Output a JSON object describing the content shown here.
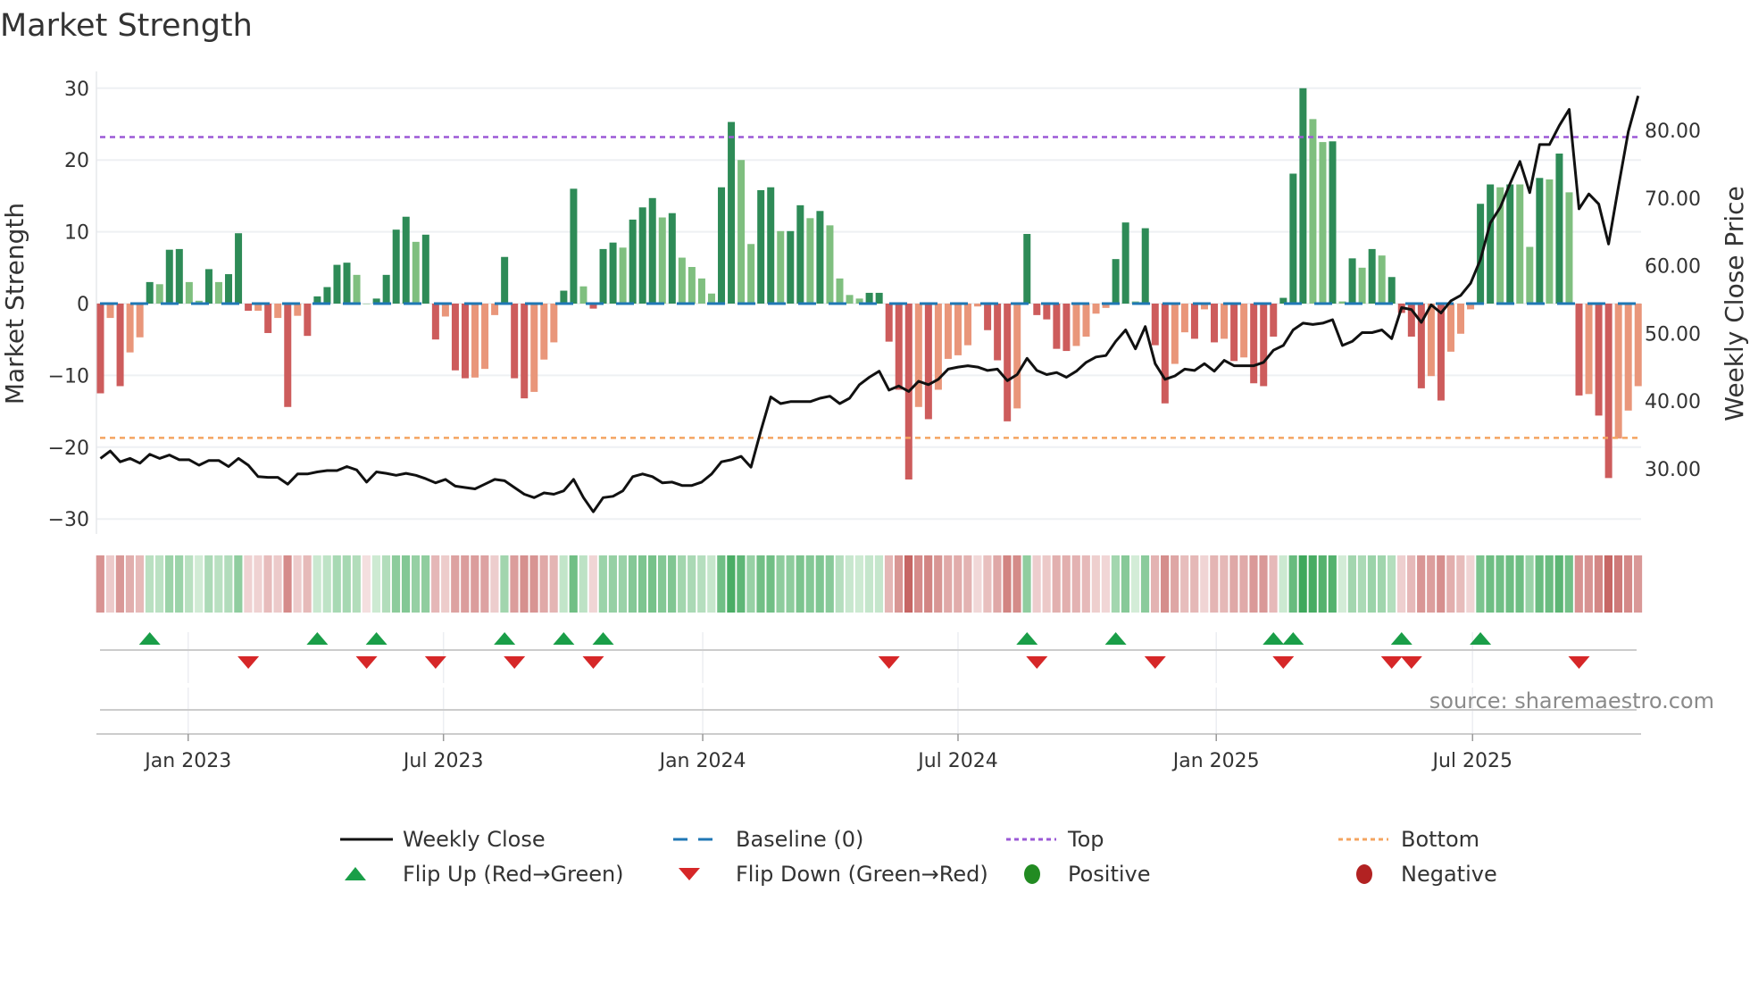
{
  "title": "Market Strength",
  "source": "source: sharemaestro.com",
  "colors": {
    "dark_green": "#2e8b57",
    "light_green": "#7fbf7f",
    "dark_red": "#cd5c5c",
    "light_red": "#e9967a",
    "baseline": "#1f77b4",
    "top": "#9b59d6",
    "bottom": "#f4a460",
    "flip_up": "#1a9e48",
    "flip_down": "#d62728",
    "positive": "#228b22",
    "negative": "#b22222"
  },
  "chart_data": {
    "type": "bar",
    "title": "Market Strength",
    "ylabel": "Market Strength",
    "y2label": "Weekly Close Price",
    "ylim": [
      -32,
      32
    ],
    "y2lim": [
      22,
      87
    ],
    "yticks": [
      "30",
      "20",
      "10",
      "0",
      "−10",
      "−20",
      "−30"
    ],
    "ytick_values": [
      30,
      20,
      10,
      0,
      -10,
      -20,
      -30
    ],
    "y2ticks": [
      "80.00",
      "70.00",
      "60.00",
      "50.00",
      "40.00",
      "30.00"
    ],
    "y2tick_values": [
      80,
      70,
      60,
      50,
      40,
      30
    ],
    "xticks": [
      "Jan 2023",
      "Jul 2023",
      "Jan 2024",
      "Jul 2024",
      "Jan 2025",
      "Jul 2025"
    ],
    "xtick_week_index": [
      8.9,
      34.8,
      61.1,
      87.0,
      113.2,
      139.2
    ],
    "top_level": 23.2,
    "bottom_level": -18.7,
    "baseline": 0,
    "strength": [
      -12.5,
      -2,
      -11.5,
      -6.8,
      -4.7,
      3,
      2.7,
      7.5,
      7.6,
      3,
      0.4,
      4.8,
      3,
      4.1,
      9.8,
      -1,
      -1,
      -4.1,
      -2,
      -14.4,
      -1.7,
      -4.5,
      1,
      2.3,
      5.4,
      5.7,
      4,
      0,
      0.7,
      4,
      10.3,
      12.1,
      8.6,
      9.6,
      -5,
      -1.8,
      -9.3,
      -10.4,
      -10.3,
      -9.1,
      -1.6,
      6.5,
      -10.4,
      -13.2,
      -12.3,
      -7.8,
      -5.4,
      1.8,
      16,
      2.4,
      -0.7,
      7.6,
      8.5,
      7.8,
      11.7,
      13.4,
      14.7,
      12,
      12.6,
      6.4,
      5.1,
      3.5,
      1.4,
      16.2,
      25.3,
      20,
      8.3,
      15.8,
      16.2,
      10.1,
      10.1,
      13.7,
      11.9,
      12.9,
      10.9,
      3.5,
      1.2,
      0.7,
      1.5,
      1.5,
      -5.3,
      -12,
      -24.5,
      -14.4,
      -16.1,
      -12,
      -7.7,
      -7.2,
      -5.8,
      -0.4,
      -3.7,
      -7.9,
      -16.4,
      -14.6,
      9.7,
      -1.6,
      -2.2,
      -6.3,
      -6.6,
      -5.9,
      -4.6,
      -1.4,
      -0.6,
      6.2,
      11.3,
      0.3,
      10.5,
      -5.8,
      -13.9,
      -8.4,
      -4,
      -4.9,
      -0.8,
      -5.4,
      -4.9,
      -8,
      -7.5,
      -11.1,
      -11.5,
      -4.6,
      0.8,
      18.1,
      30,
      25.7,
      22.5,
      22.6,
      0.3,
      6.3,
      5,
      7.6,
      6.7,
      3.7,
      -1.3,
      -4.6,
      -11.8,
      -10.1,
      -13.5,
      -6.7,
      -4.2,
      -0.8,
      13.9,
      16.6,
      16.2,
      16.6,
      16.6,
      7.9,
      17.5,
      17.3,
      20.9,
      15.5,
      -12.8,
      -12.6,
      -15.6,
      -24.3,
      -18.8,
      -14.9,
      -11.5
    ],
    "strength_dark": [
      1,
      0,
      1,
      0,
      0,
      1,
      0,
      1,
      1,
      0,
      0,
      1,
      0,
      1,
      1,
      1,
      0,
      1,
      0,
      1,
      0,
      1,
      1,
      1,
      1,
      1,
      0,
      0,
      1,
      1,
      1,
      1,
      0,
      1,
      1,
      0,
      1,
      1,
      0,
      0,
      0,
      1,
      1,
      1,
      0,
      0,
      0,
      1,
      1,
      0,
      1,
      1,
      1,
      0,
      1,
      1,
      1,
      0,
      1,
      0,
      0,
      0,
      0,
      1,
      1,
      0,
      0,
      1,
      1,
      0,
      1,
      1,
      0,
      1,
      0,
      0,
      0,
      0,
      1,
      1,
      1,
      1,
      1,
      0,
      1,
      0,
      0,
      0,
      0,
      0,
      1,
      1,
      1,
      0,
      1,
      1,
      1,
      1,
      1,
      0,
      0,
      0,
      0,
      1,
      1,
      0,
      1,
      1,
      1,
      0,
      0,
      1,
      0,
      1,
      0,
      1,
      0,
      1,
      1,
      1,
      1,
      1,
      1,
      0,
      0,
      1,
      0,
      1,
      0,
      1,
      0,
      1,
      1,
      1,
      1,
      0,
      1,
      0,
      0,
      0,
      1,
      1,
      0,
      1,
      0,
      0,
      1,
      0,
      1,
      0,
      1,
      0,
      1,
      1,
      0,
      0,
      0
    ],
    "weekly_close": [
      31.5,
      32.6,
      31.0,
      31.5,
      30.8,
      32.1,
      31.5,
      32.0,
      31.3,
      31.3,
      30.5,
      31.2,
      31.2,
      30.3,
      31.5,
      30.5,
      28.8,
      28.7,
      28.7,
      27.7,
      29.2,
      29.2,
      29.5,
      29.7,
      29.7,
      30.3,
      29.8,
      28.0,
      29.5,
      29.3,
      29.0,
      29.3,
      29.0,
      28.5,
      27.9,
      28.4,
      27.4,
      27.2,
      27.0,
      27.7,
      28.4,
      28.2,
      27.2,
      26.2,
      25.7,
      26.4,
      26.2,
      26.7,
      28.4,
      25.7,
      23.6,
      25.7,
      25.9,
      26.7,
      28.8,
      29.2,
      28.8,
      27.9,
      28.0,
      27.5,
      27.5,
      28.0,
      29.2,
      31.0,
      31.3,
      31.8,
      30.2,
      35.6,
      40.6,
      39.6,
      39.9,
      39.9,
      39.9,
      40.4,
      40.7,
      39.6,
      40.4,
      42.4,
      43.5,
      44.4,
      41.6,
      42.2,
      41.4,
      42.9,
      42.4,
      43.2,
      44.7,
      45.0,
      45.2,
      45.0,
      44.5,
      44.7,
      43.0,
      43.9,
      46.3,
      44.5,
      43.9,
      44.2,
      43.5,
      44.4,
      45.7,
      46.5,
      46.7,
      48.8,
      50.5,
      47.7,
      51.0,
      45.5,
      43.2,
      43.7,
      44.7,
      44.5,
      45.5,
      44.4,
      46.0,
      45.2,
      45.2,
      45.2,
      45.7,
      47.5,
      48.2,
      50.5,
      51.5,
      51.3,
      51.5,
      52.0,
      48.2,
      48.8,
      50.1,
      50.1,
      50.5,
      49.2,
      53.8,
      53.5,
      51.6,
      54.2,
      53.0,
      54.8,
      55.6,
      57.4,
      60.9,
      66.3,
      68.6,
      72.1,
      75.4,
      70.8,
      77.9,
      77.9,
      80.7,
      83.1,
      68.4,
      70.6,
      69.1,
      63.2,
      71.7,
      79.8,
      85.1
    ],
    "flip_up_week_index": [
      5,
      22,
      28,
      41,
      47,
      51,
      94,
      103,
      119,
      121,
      132,
      140
    ],
    "flip_down_week_index": [
      15,
      27,
      34,
      42,
      50,
      80,
      95,
      107,
      120,
      131,
      133,
      150
    ],
    "legend": {
      "weekly_close": "Weekly Close",
      "baseline": "Baseline (0)",
      "top": "Top",
      "bottom": "Bottom",
      "flip_up": "Flip Up (Red→Green)",
      "flip_down": "Flip Down (Green→Red)",
      "positive": "Positive",
      "negative": "Negative"
    },
    "legend_position": "bottom"
  }
}
